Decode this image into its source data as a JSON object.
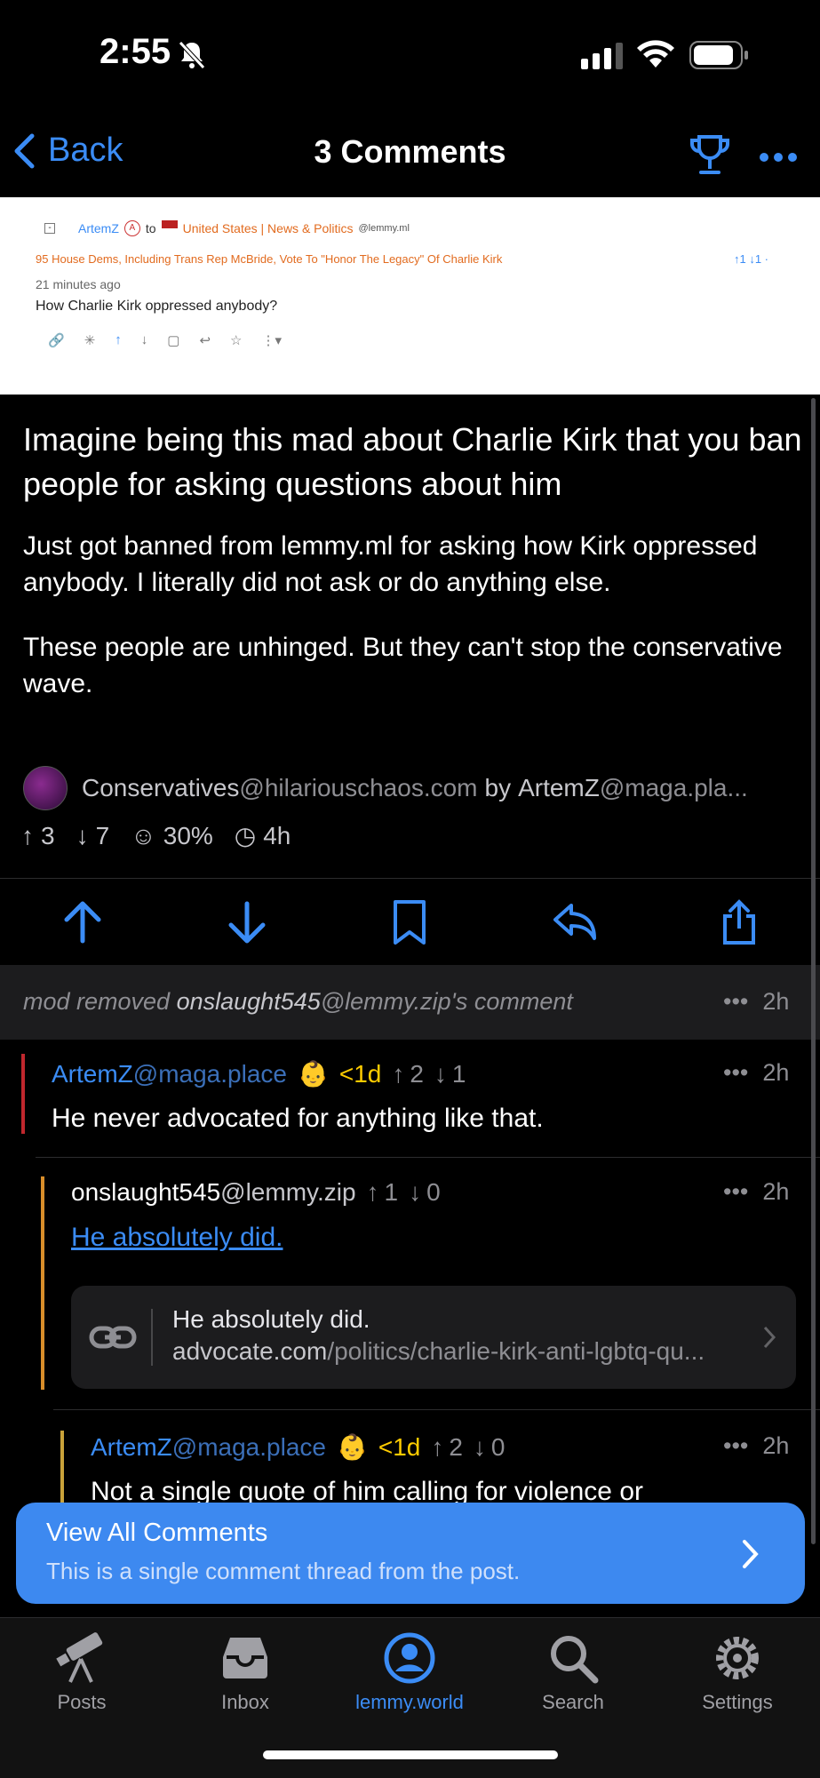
{
  "status_bar": {
    "time": "2:55"
  },
  "nav": {
    "back_label": "Back",
    "title": "3 Comments"
  },
  "screenshot": {
    "author": "ArtemZ",
    "author_badge": "A",
    "to": "to",
    "community": "United States | News & Politics",
    "community_instance": "@lemmy.ml",
    "post_title": "95 House Dems, Including Trans Rep McBride, Vote To \"Honor The Legacy\" Of Charlie Kirk",
    "votes": "↑1 ↓1 ·",
    "timestamp": "21 minutes ago",
    "comment": "How Charlie Kirk oppressed anybody?"
  },
  "post": {
    "title": "Imagine being this mad about Charlie Kirk that you ban people for asking questions about him",
    "body_p1": "Just got banned from lemmy.ml for asking how Kirk oppressed anybody. I literally did not ask or do anything else.",
    "body_p2": "These people are unhinged. But they can't stop the conservative wave.",
    "community_name": "Conservatives",
    "community_instance": "@hilariouschaos.com",
    "by": "by",
    "author": "ArtemZ",
    "author_instance": "@maga.pla...",
    "upvotes": "3",
    "downvotes": "7",
    "ratio": "30%",
    "age": "4h"
  },
  "mod_notice": {
    "prefix": "mod removed",
    "user": "onslaught545",
    "instance": "@lemmy.zip",
    "suffix": "'s comment",
    "time": "2h"
  },
  "comments": [
    {
      "user": "ArtemZ",
      "instance": "@maga.place",
      "badge": "<1d",
      "up": "2",
      "down": "1",
      "time": "2h",
      "text": "He never advocated for anything like that."
    },
    {
      "user": "onslaught545",
      "instance": "@lemmy.zip",
      "up": "1",
      "down": "0",
      "time": "2h",
      "link_text": "He absolutely did.",
      "card_title": "He absolutely did.",
      "card_domain": "advocate.com",
      "card_path": "/politics/charlie-kirk-anti-lgbtq-qu..."
    },
    {
      "user": "ArtemZ",
      "instance": "@maga.place",
      "badge": "<1d",
      "up": "2",
      "down": "0",
      "time": "2h",
      "text": "Not a single quote of him calling for violence or"
    }
  ],
  "view_all": {
    "title": "View All Comments",
    "subtitle": "This is a single comment thread from the post."
  },
  "tabs": [
    {
      "label": "Posts",
      "icon": "telescope-icon"
    },
    {
      "label": "Inbox",
      "icon": "inbox-icon"
    },
    {
      "label": "lemmy.world",
      "icon": "account-icon"
    },
    {
      "label": "Search",
      "icon": "search-icon"
    },
    {
      "label": "Settings",
      "icon": "gear-icon"
    }
  ],
  "colors": {
    "accent": "#3b8cf5",
    "background": "#000000",
    "badge": "#ffcc00",
    "thread_red": "#c0272d",
    "thread_orange": "#d98e2a",
    "thread_yellow": "#c9a23a"
  }
}
